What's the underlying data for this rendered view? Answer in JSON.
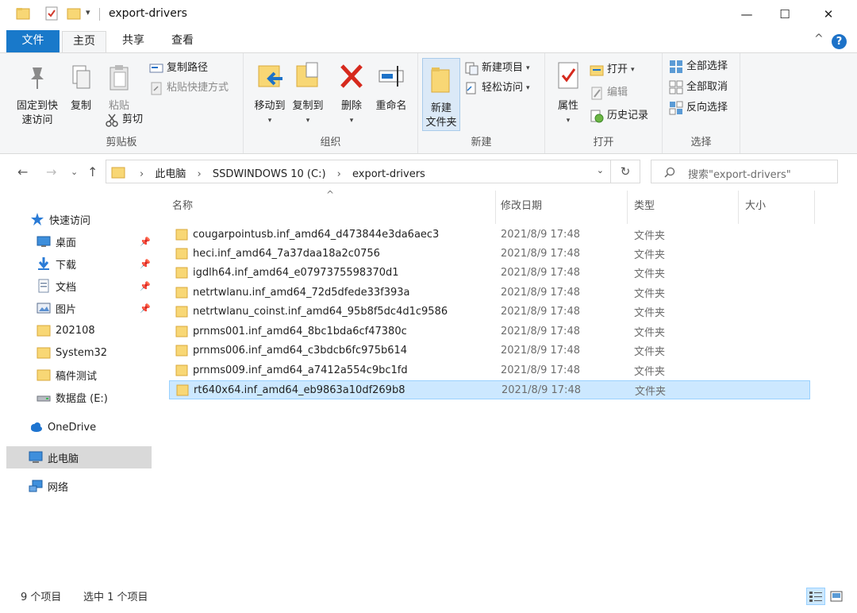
{
  "window": {
    "title": "export-drivers",
    "controls": {
      "minimize": "—",
      "maximize": "☐",
      "close": "✕"
    }
  },
  "ribbon_tabs": [
    {
      "label": "文件"
    },
    {
      "label": "主页"
    },
    {
      "label": "共享"
    },
    {
      "label": "查看"
    }
  ],
  "ribbon": {
    "clipboard": {
      "pin_quick_access": [
        "固定到快",
        "速访问"
      ],
      "copy": "复制",
      "paste": "粘贴",
      "copy_path": "复制路径",
      "paste_shortcut": "粘贴快捷方式",
      "cut": "剪切",
      "label": "剪贴板"
    },
    "organize": {
      "move_to": "移动到",
      "copy_to": "复制到",
      "delete": "删除",
      "rename": "重命名",
      "label": "组织"
    },
    "new": {
      "new_folder": [
        "新建",
        "文件夹"
      ],
      "new_item": "新建项目",
      "easy_access": "轻松访问",
      "label": "新建"
    },
    "open": {
      "properties": "属性",
      "open": "打开",
      "edit": "编辑",
      "history": "历史记录",
      "label": "打开"
    },
    "select": {
      "select_all": "全部选择",
      "select_none": "全部取消",
      "invert": "反向选择",
      "label": "选择"
    }
  },
  "address": {
    "crumbs": [
      "此电脑",
      "SSDWINDOWS 10 (C:)",
      "export-drivers"
    ],
    "search_placeholder": "搜索\"export-drivers\""
  },
  "sidebar": {
    "items": [
      {
        "label": "快速访问",
        "icon": "star-icon"
      },
      {
        "label": "桌面",
        "icon": "desktop-icon",
        "pinned": true
      },
      {
        "label": "下载",
        "icon": "download-icon",
        "pinned": true
      },
      {
        "label": "文档",
        "icon": "document-icon",
        "pinned": true
      },
      {
        "label": "图片",
        "icon": "picture-icon",
        "pinned": true
      },
      {
        "label": "202108",
        "icon": "folder-icon"
      },
      {
        "label": "System32",
        "icon": "folder-icon"
      },
      {
        "label": "稿件测试",
        "icon": "folder-icon"
      },
      {
        "label": "数据盘 (E:)",
        "icon": "drive-icon"
      },
      {
        "label": "OneDrive",
        "icon": "cloud-icon"
      },
      {
        "label": "此电脑",
        "icon": "computer-icon",
        "selected": true
      },
      {
        "label": "网络",
        "icon": "network-icon"
      }
    ]
  },
  "columns": {
    "name": "名称",
    "date": "修改日期",
    "type": "类型",
    "size": "大小"
  },
  "files": [
    {
      "name": "cougarpointusb.inf_amd64_d473844e3da6aec3",
      "date": "2021/8/9 17:48",
      "type": "文件夹"
    },
    {
      "name": "heci.inf_amd64_7a37daa18a2c0756",
      "date": "2021/8/9 17:48",
      "type": "文件夹"
    },
    {
      "name": "igdlh64.inf_amd64_e0797375598370d1",
      "date": "2021/8/9 17:48",
      "type": "文件夹"
    },
    {
      "name": "netrtwlanu.inf_amd64_72d5dfede33f393a",
      "date": "2021/8/9 17:48",
      "type": "文件夹"
    },
    {
      "name": "netrtwlanu_coinst.inf_amd64_95b8f5dc4d1c9586",
      "date": "2021/8/9 17:48",
      "type": "文件夹"
    },
    {
      "name": "prnms001.inf_amd64_8bc1bda6cf47380c",
      "date": "2021/8/9 17:48",
      "type": "文件夹"
    },
    {
      "name": "prnms006.inf_amd64_c3bdcb6fc975b614",
      "date": "2021/8/9 17:48",
      "type": "文件夹"
    },
    {
      "name": "prnms009.inf_amd64_a7412a554c9bc1fd",
      "date": "2021/8/9 17:48",
      "type": "文件夹"
    },
    {
      "name": "rt640x64.inf_amd64_eb9863a10df269b8",
      "date": "2021/8/9 17:48",
      "type": "文件夹",
      "selected": true
    }
  ],
  "status": {
    "count": "9 个项目",
    "selected": "选中 1 个项目"
  },
  "colors": {
    "accent": "#1979ca",
    "selection": "#cce8ff",
    "folder": "#f8d775"
  }
}
